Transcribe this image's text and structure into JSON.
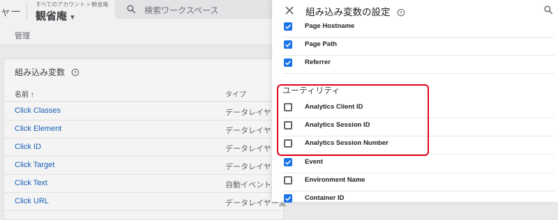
{
  "app": {
    "brand_tail": "ャー",
    "breadcrumb": "すべてのアカウント > 観省庵",
    "container_name": "観省庵",
    "search": {
      "placeholder": "検索ワークスペース"
    },
    "subnav": {
      "admin": "管理"
    }
  },
  "builtin_card": {
    "title": "組み込み変数",
    "col_name": "名前 ↑",
    "col_type": "タイプ",
    "rows": [
      {
        "name": "Click Classes",
        "type": "データレイヤー変"
      },
      {
        "name": "Click Element",
        "type": "データレイヤー変"
      },
      {
        "name": "Click ID",
        "type": "データレイヤー変"
      },
      {
        "name": "Click Target",
        "type": "データレイヤー変"
      },
      {
        "name": "Click Text",
        "type": "自動イベント変数"
      },
      {
        "name": "Click URL",
        "type": "データレイヤー変"
      }
    ]
  },
  "panel": {
    "title": "組み込み変数の設定",
    "items_top": [
      {
        "label": "Page Hostname",
        "checked": true
      },
      {
        "label": "Page Path",
        "checked": true
      },
      {
        "label": "Referrer",
        "checked": true
      }
    ],
    "utility_title": "ユーティリティ",
    "items_utility": [
      {
        "label": "Analytics Client ID",
        "checked": false
      },
      {
        "label": "Analytics Session ID",
        "checked": false
      },
      {
        "label": "Analytics Session Number",
        "checked": false
      },
      {
        "label": "Event",
        "checked": true
      },
      {
        "label": "Environment Name",
        "checked": false
      },
      {
        "label": "Container ID",
        "checked": true
      }
    ]
  },
  "colors": {
    "accent": "#1a73e8",
    "highlight": "#e5001a",
    "link": "#1a5fb4"
  }
}
